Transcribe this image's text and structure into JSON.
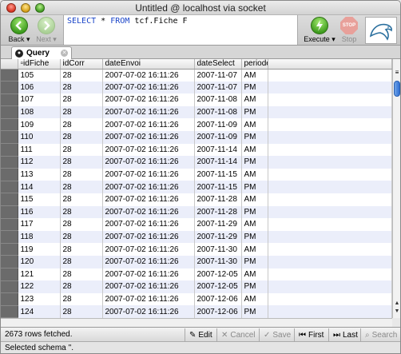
{
  "window": {
    "title": "Untitled @ localhost via socket"
  },
  "toolbar": {
    "back_label": "Back",
    "next_label": "Next",
    "sql_keyword_select": "SELECT",
    "sql_star": "*",
    "sql_keyword_from": "FROM",
    "sql_table": "tcf.Fiche F",
    "execute_label": "Execute",
    "stop_label": "Stop",
    "stop_icon_text": "STOP"
  },
  "tabs": [
    {
      "label": "Query"
    }
  ],
  "grid": {
    "columns": [
      "idFiche",
      "idCorr",
      "dateEnvoi",
      "dateSelect",
      "periode"
    ],
    "rows": [
      [
        "105",
        "28",
        "2007-07-02 16:11:26",
        "2007-11-07",
        "AM"
      ],
      [
        "106",
        "28",
        "2007-07-02 16:11:26",
        "2007-11-07",
        "PM"
      ],
      [
        "107",
        "28",
        "2007-07-02 16:11:26",
        "2007-11-08",
        "AM"
      ],
      [
        "108",
        "28",
        "2007-07-02 16:11:26",
        "2007-11-08",
        "PM"
      ],
      [
        "109",
        "28",
        "2007-07-02 16:11:26",
        "2007-11-09",
        "AM"
      ],
      [
        "110",
        "28",
        "2007-07-02 16:11:26",
        "2007-11-09",
        "PM"
      ],
      [
        "111",
        "28",
        "2007-07-02 16:11:26",
        "2007-11-14",
        "AM"
      ],
      [
        "112",
        "28",
        "2007-07-02 16:11:26",
        "2007-11-14",
        "PM"
      ],
      [
        "113",
        "28",
        "2007-07-02 16:11:26",
        "2007-11-15",
        "AM"
      ],
      [
        "114",
        "28",
        "2007-07-02 16:11:26",
        "2007-11-15",
        "PM"
      ],
      [
        "115",
        "28",
        "2007-07-02 16:11:26",
        "2007-11-28",
        "AM"
      ],
      [
        "116",
        "28",
        "2007-07-02 16:11:26",
        "2007-11-28",
        "PM"
      ],
      [
        "117",
        "28",
        "2007-07-02 16:11:26",
        "2007-11-29",
        "AM"
      ],
      [
        "118",
        "28",
        "2007-07-02 16:11:26",
        "2007-11-29",
        "PM"
      ],
      [
        "119",
        "28",
        "2007-07-02 16:11:26",
        "2007-11-30",
        "AM"
      ],
      [
        "120",
        "28",
        "2007-07-02 16:11:26",
        "2007-11-30",
        "PM"
      ],
      [
        "121",
        "28",
        "2007-07-02 16:11:26",
        "2007-12-05",
        "AM"
      ],
      [
        "122",
        "28",
        "2007-07-02 16:11:26",
        "2007-12-05",
        "PM"
      ],
      [
        "123",
        "28",
        "2007-07-02 16:11:26",
        "2007-12-06",
        "AM"
      ],
      [
        "124",
        "28",
        "2007-07-02 16:11:26",
        "2007-12-06",
        "PM"
      ],
      [
        "125",
        "28",
        "2007-07-02 16:11:26",
        "2007-12-07",
        "AM"
      ],
      [
        "126",
        "28",
        "2007-07-02 16:11:26",
        "2007-12-07",
        "PM"
      ],
      [
        "253",
        "36",
        "2007-07-02 17:34:30",
        "2007-10-31",
        "AM"
      ]
    ]
  },
  "bottombar": {
    "rows_fetched": "2673 rows fetched.",
    "edit_label": "Edit",
    "cancel_label": "Cancel",
    "save_label": "Save",
    "first_label": "First",
    "last_label": "Last",
    "search_label": "Search"
  },
  "status": {
    "text": "Selected schema ''."
  },
  "colors": {
    "accent": "#1a44c8",
    "row_alt": "#ebeefa",
    "row_header": "#6b6b6b"
  }
}
